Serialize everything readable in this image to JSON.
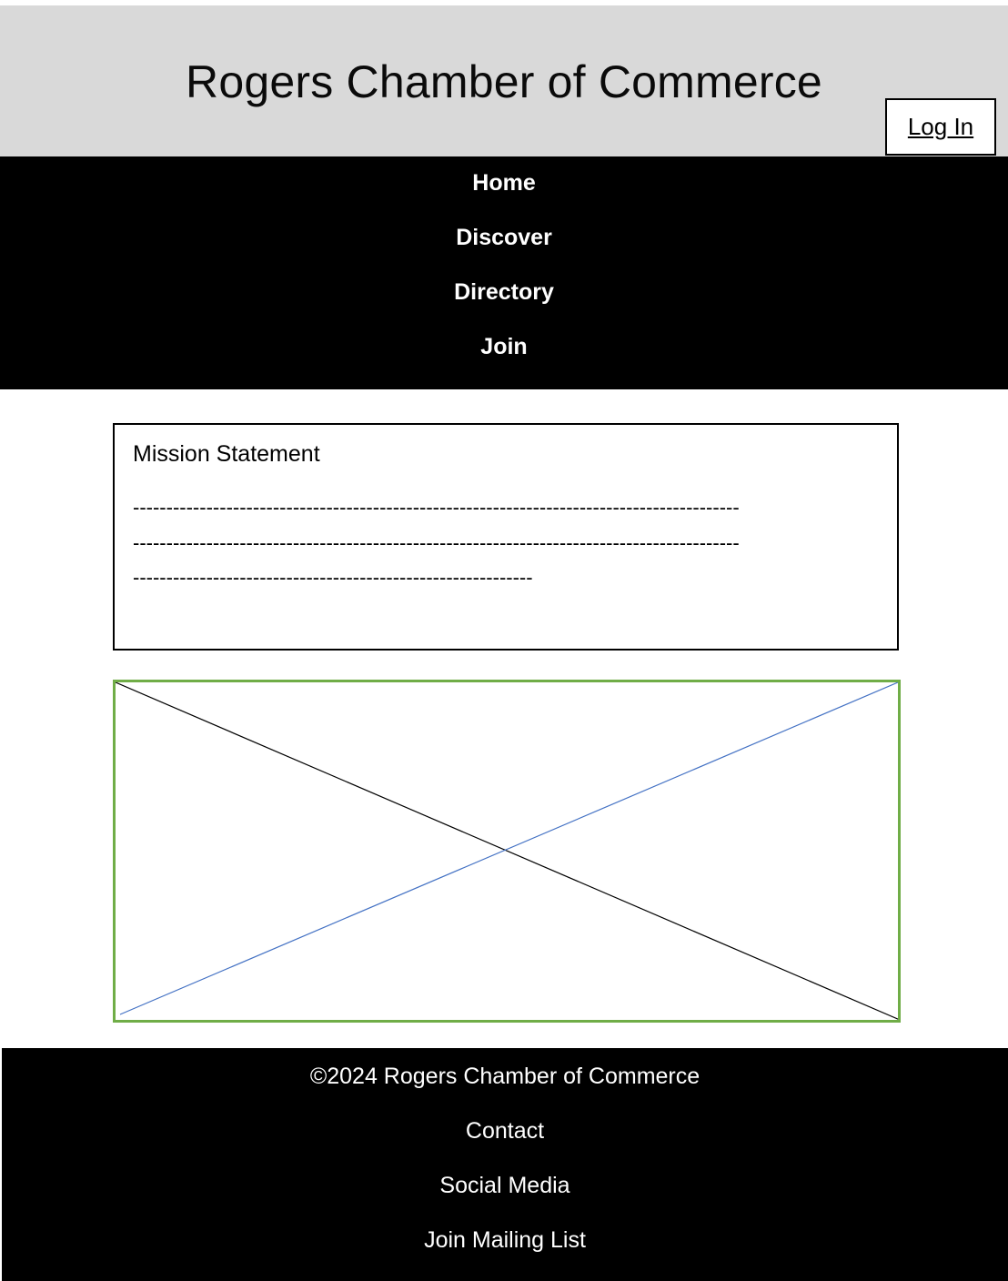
{
  "header": {
    "title": "Rogers Chamber of Commerce",
    "login_label": "Log In"
  },
  "nav": {
    "items": [
      {
        "label": "Home"
      },
      {
        "label": "Discover"
      },
      {
        "label": "Directory"
      },
      {
        "label": "Join"
      }
    ]
  },
  "mission": {
    "title": "Mission Statement",
    "lines": [
      "-------------------------------------------------------------------------------------------",
      "-------------------------------------------------------------------------------------------",
      "------------------------------------------------------------"
    ]
  },
  "image_placeholder": {
    "border_color": "#70ad47",
    "diagonal_1_color": "#000000",
    "diagonal_2_color": "#4472c4"
  },
  "footer": {
    "copyright": "©2024 Rogers Chamber of Commerce",
    "links": [
      {
        "label": "Contact"
      },
      {
        "label": "Social Media"
      },
      {
        "label": "Join Mailing List"
      }
    ]
  }
}
